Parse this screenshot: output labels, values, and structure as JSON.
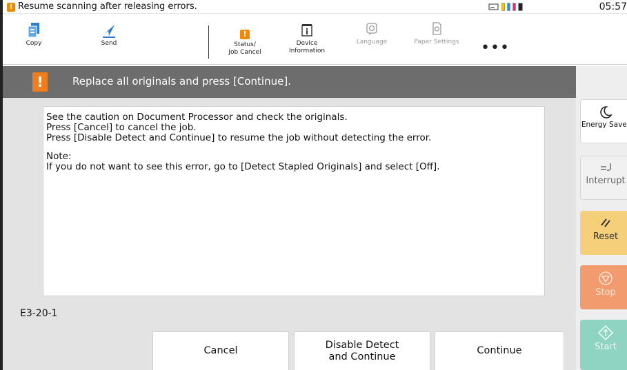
{
  "status_bar": {
    "message": "Resume scanning after releasing errors.",
    "time": "05:57",
    "warn_icon": "warning-icon",
    "toner_colors": [
      "#f5c400",
      "#2a8de0",
      "#e0317b",
      "#222222"
    ]
  },
  "toolbar": {
    "items": [
      {
        "label": "Copy",
        "icon": "copy-icon"
      },
      {
        "label": "Send",
        "icon": "send-icon"
      },
      {
        "label_line1": "Status/",
        "label_line2": "Job Cancel",
        "icon": "warning-icon"
      },
      {
        "label_line1": "Device",
        "label_line2": "Information",
        "icon": "device-info-icon"
      },
      {
        "label": "Language",
        "icon": "language-icon"
      },
      {
        "label": "Paper Settings",
        "icon": "paper-settings-icon"
      }
    ],
    "more_label": "•••"
  },
  "alert": {
    "text": "Replace all originals and press [Continue].",
    "icon_glyph": "!"
  },
  "message": {
    "line1": "See the caution on Document Processor and check the originals.",
    "line2": "Press [Cancel] to cancel the job.",
    "line3": "Press [Disable Detect and Continue] to resume the job without detecting the error.",
    "line4": "Note:",
    "line5": "If you do not want to see this error, go to [Detect Stapled Originals] and select [Off]."
  },
  "error_code": "E3-20-1",
  "buttons": {
    "cancel": "Cancel",
    "disable_line1": "Disable Detect",
    "disable_line2": "and Continue",
    "continue": "Continue"
  },
  "right_panel": {
    "energy_saver": "Energy Saver",
    "interrupt": "Interrupt",
    "reset": "Reset",
    "stop": "Stop",
    "start": "Start"
  },
  "colors": {
    "accent_orange": "#f07e1c",
    "alert_bg": "#6d6d6d",
    "reset_bg": "#f5cf79",
    "stop_bg": "#f29b6f",
    "start_bg": "#8fd3c2",
    "tool_blue": "#2a7fd0"
  }
}
